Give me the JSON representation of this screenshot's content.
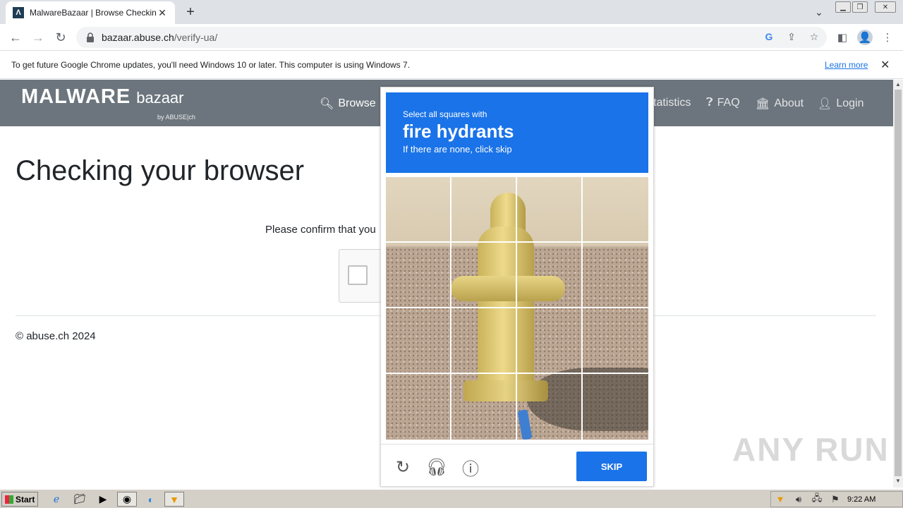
{
  "browser": {
    "tab_title": "MalwareBazaar | Browse Checking y",
    "tab_close": "✕",
    "new_tab": "+",
    "url_host": "bazaar.abuse.ch",
    "url_path": "/verify-ua/"
  },
  "infobar": {
    "message": "To get future Google Chrome updates, you'll need Windows 10 or later. This computer is using Windows 7.",
    "link": "Learn more",
    "close": "✕"
  },
  "site": {
    "logo_main": "MALWARE",
    "logo_sub": "bazaar",
    "logo_by": "by ABUSE|ch",
    "nav": {
      "browse": "Browse",
      "statistics": "tatistics",
      "faq": "FAQ",
      "about": "About",
      "login": "Login"
    },
    "title": "Checking your browser",
    "confirm": "Please confirm that you",
    "footer": "© abuse.ch 2024"
  },
  "captcha": {
    "line1": "Select all squares with",
    "line2": "fire hydrants",
    "line3": "If there are none, click skip",
    "skip": "SKIP",
    "icons": [
      "refresh-icon",
      "headphones-icon",
      "info-icon"
    ]
  },
  "watermark": "ANY RUN",
  "taskbar": {
    "start": "Start",
    "clock": "9:22 AM"
  },
  "colors": {
    "captcha_blue": "#1a73e8",
    "site_header": "#6c757d"
  }
}
